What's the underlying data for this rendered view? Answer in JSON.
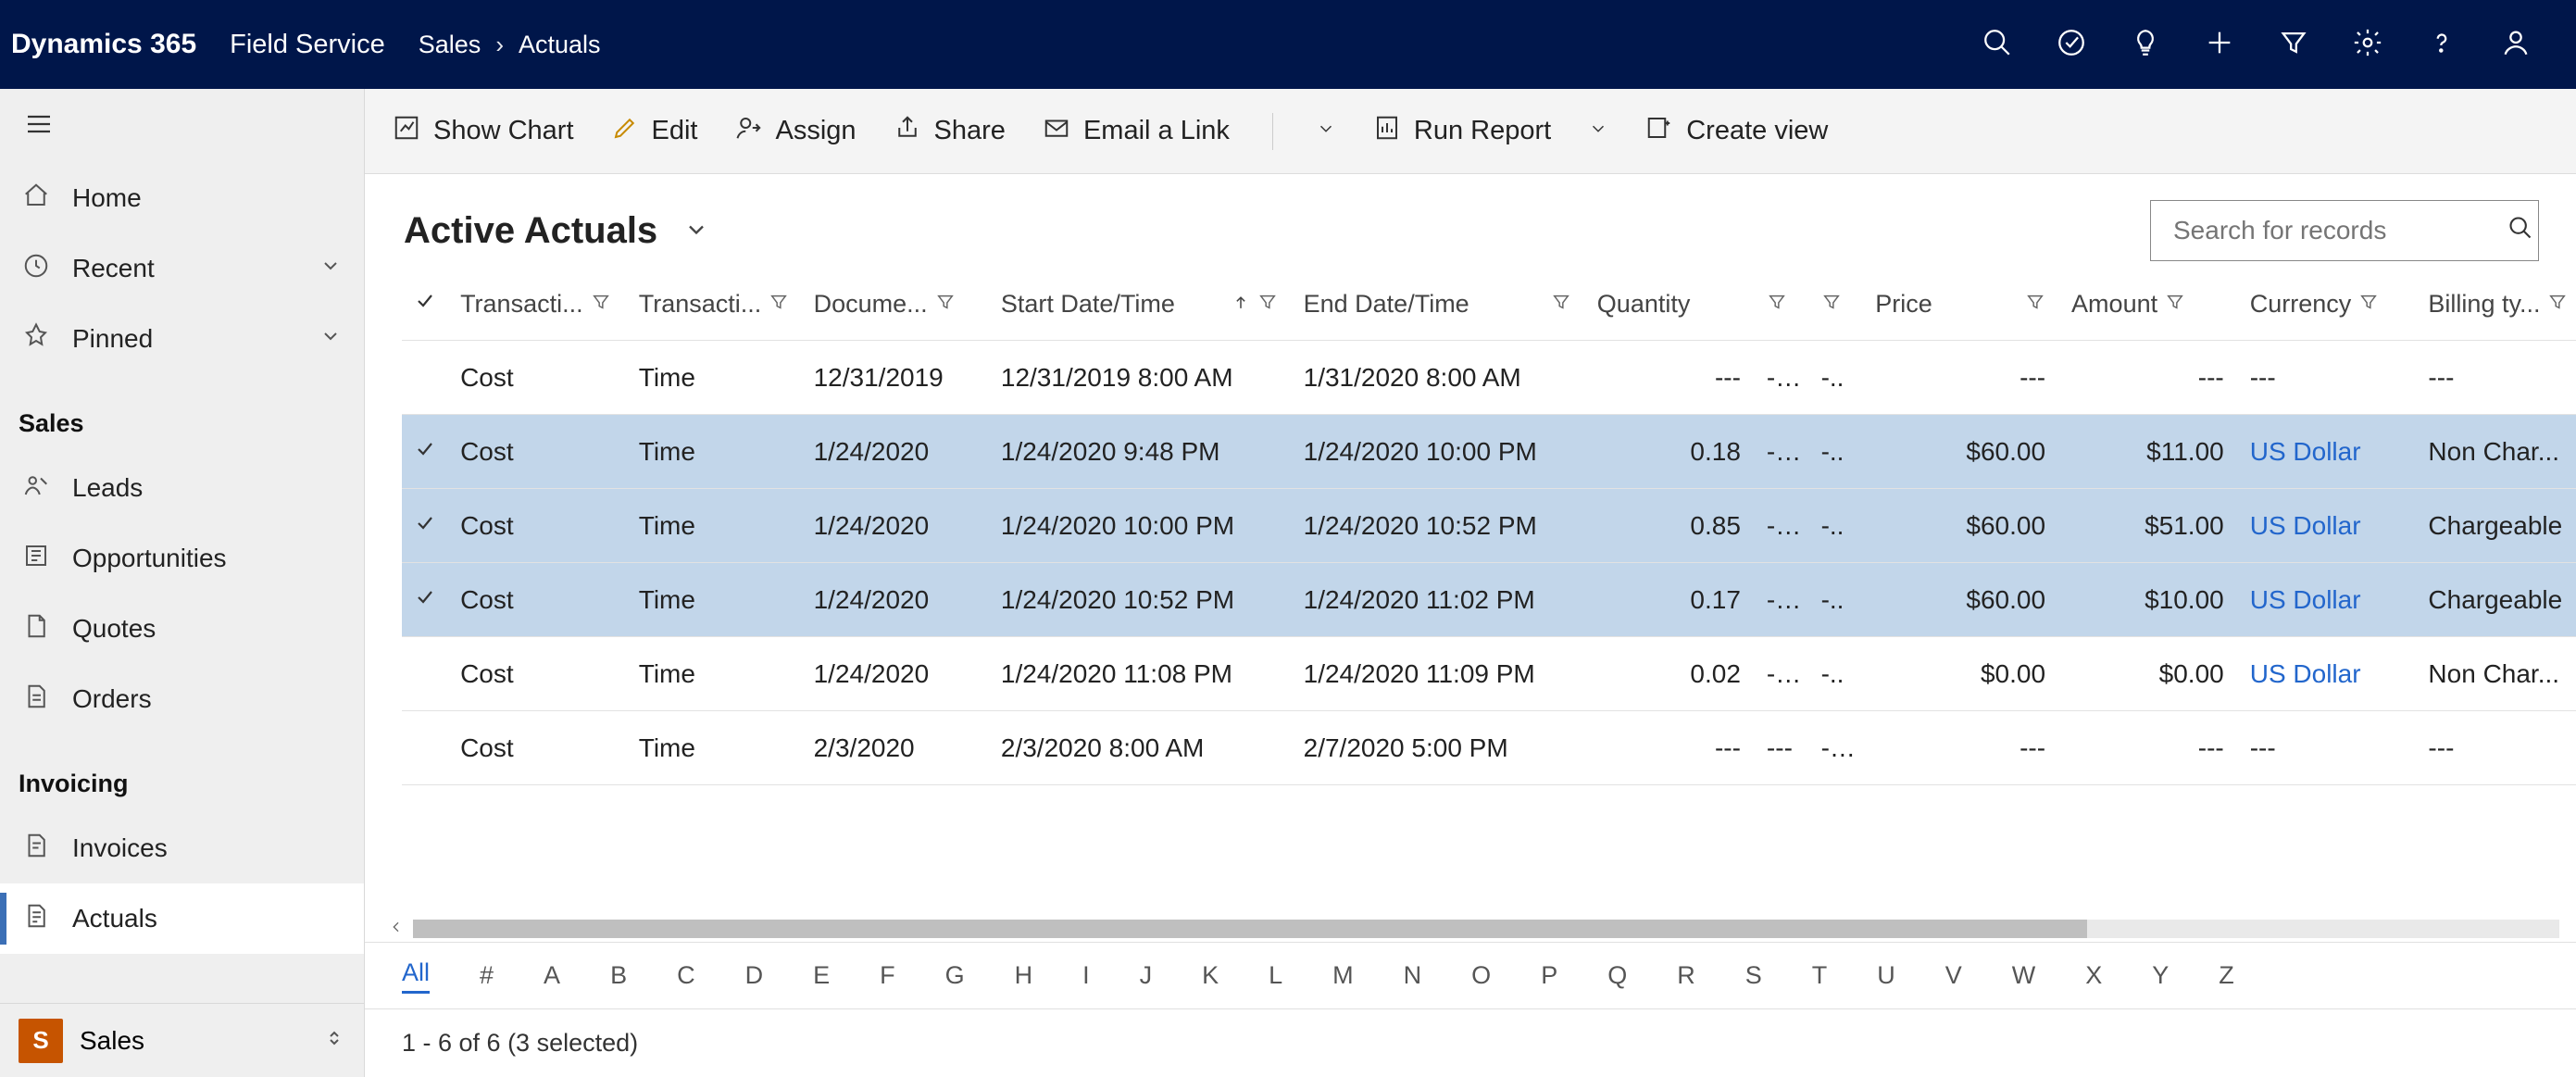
{
  "header": {
    "brand": "Dynamics 365",
    "product": "Field Service",
    "breadcrumb": [
      "Sales",
      "Actuals"
    ]
  },
  "sidebar": {
    "nav": [
      {
        "key": "home",
        "label": "Home"
      },
      {
        "key": "recent",
        "label": "Recent",
        "expandable": true
      },
      {
        "key": "pinned",
        "label": "Pinned",
        "expandable": true
      }
    ],
    "sections": [
      {
        "title": "Sales",
        "items": [
          {
            "key": "leads",
            "label": "Leads"
          },
          {
            "key": "opps",
            "label": "Opportunities"
          },
          {
            "key": "quotes",
            "label": "Quotes"
          },
          {
            "key": "orders",
            "label": "Orders"
          }
        ]
      },
      {
        "title": "Invoicing",
        "items": [
          {
            "key": "invoices",
            "label": "Invoices"
          },
          {
            "key": "actuals",
            "label": "Actuals",
            "active": true
          }
        ]
      }
    ],
    "app_switch": {
      "badge": "S",
      "label": "Sales"
    }
  },
  "commands": {
    "show_chart": "Show Chart",
    "edit": "Edit",
    "assign": "Assign",
    "share": "Share",
    "email_link": "Email a Link",
    "run_report": "Run Report",
    "create_view": "Create view"
  },
  "view": {
    "title": "Active Actuals",
    "search_placeholder": "Search for records"
  },
  "grid": {
    "columns": {
      "transaction_class": "Transacti...",
      "transaction_type": "Transacti...",
      "document_date": "Docume...",
      "start": "Start Date/Time",
      "end": "End Date/Time",
      "quantity": "Quantity",
      "price": "Price",
      "amount": "Amount",
      "currency": "Currency",
      "billing_type": "Billing ty..."
    },
    "rows": [
      {
        "sel": false,
        "tclass": "Cost",
        "ttype": "Time",
        "doc": "12/31/2019",
        "start": "12/31/2019 8:00 AM",
        "end": "1/31/2020 8:00 AM",
        "qty": "---",
        "i1": "-...",
        "i2": "-..",
        "price": "---",
        "amount": "---",
        "curr": "---",
        "bill": "---"
      },
      {
        "sel": true,
        "tclass": "Cost",
        "ttype": "Time",
        "doc": "1/24/2020",
        "start": "1/24/2020 9:48 PM",
        "end": "1/24/2020 10:00 PM",
        "qty": "0.18",
        "i1": "-...",
        "i2": "-..",
        "price": "$60.00",
        "amount": "$11.00",
        "curr": "US Dollar",
        "bill": "Non Char..."
      },
      {
        "sel": true,
        "tclass": "Cost",
        "ttype": "Time",
        "doc": "1/24/2020",
        "start": "1/24/2020 10:00 PM",
        "end": "1/24/2020 10:52 PM",
        "qty": "0.85",
        "i1": "-...",
        "i2": "-..",
        "price": "$60.00",
        "amount": "$51.00",
        "curr": "US Dollar",
        "bill": "Chargeable"
      },
      {
        "sel": true,
        "tclass": "Cost",
        "ttype": "Time",
        "doc": "1/24/2020",
        "start": "1/24/2020 10:52 PM",
        "end": "1/24/2020 11:02 PM",
        "qty": "0.17",
        "i1": "-...",
        "i2": "-..",
        "price": "$60.00",
        "amount": "$10.00",
        "curr": "US Dollar",
        "bill": "Chargeable"
      },
      {
        "sel": false,
        "tclass": "Cost",
        "ttype": "Time",
        "doc": "1/24/2020",
        "start": "1/24/2020 11:08 PM",
        "end": "1/24/2020 11:09 PM",
        "qty": "0.02",
        "i1": "-...",
        "i2": "-..",
        "price": "$0.00",
        "amount": "$0.00",
        "curr": "US Dollar",
        "bill": "Non Char..."
      },
      {
        "sel": false,
        "tclass": "Cost",
        "ttype": "Time",
        "doc": "2/3/2020",
        "start": "2/3/2020 8:00 AM",
        "end": "2/7/2020 5:00 PM",
        "qty": "---",
        "i1": "---",
        "i2": "-...",
        "price": "---",
        "amount": "---",
        "curr": "---",
        "bill": "---"
      }
    ]
  },
  "alphabar": [
    "All",
    "#",
    "A",
    "B",
    "C",
    "D",
    "E",
    "F",
    "G",
    "H",
    "I",
    "J",
    "K",
    "L",
    "M",
    "N",
    "O",
    "P",
    "Q",
    "R",
    "S",
    "T",
    "U",
    "V",
    "W",
    "X",
    "Y",
    "Z"
  ],
  "status": "1 - 6 of 6 (3 selected)"
}
